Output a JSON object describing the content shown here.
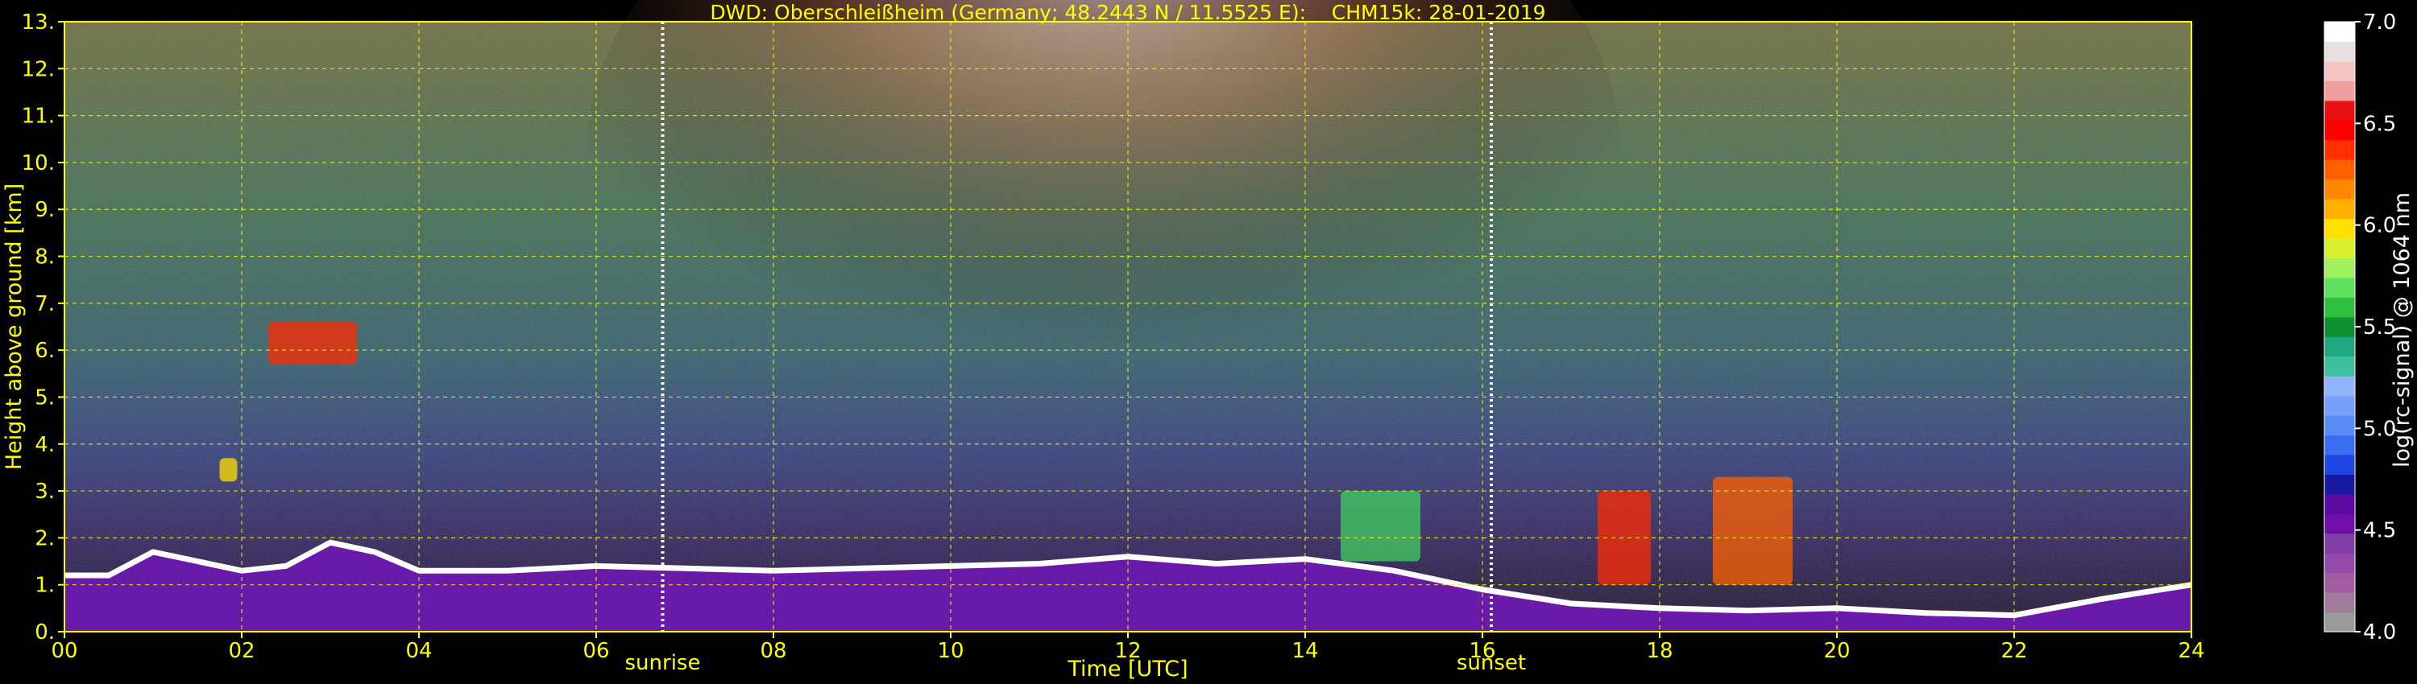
{
  "chart_data": {
    "type": "heatmap",
    "title": "DWD: Oberschleißheim (Germany; 48.2443 N / 11.5525 E):    CHM15k: 28-01-2019",
    "xlabel": "Time [UTC]",
    "ylabel": "Height above ground [km]",
    "xlim": [
      0,
      24
    ],
    "ylim": [
      0,
      13
    ],
    "x_ticks": [
      "00",
      "02",
      "04",
      "06",
      "08",
      "10",
      "12",
      "14",
      "16",
      "18",
      "20",
      "22",
      "24"
    ],
    "y_ticks": [
      "0.",
      "1.",
      "2.",
      "3.",
      "4.",
      "5.",
      "6.",
      "7.",
      "8.",
      "9.",
      "10.",
      "11.",
      "12.",
      "13."
    ],
    "grid": true,
    "markers": [
      {
        "label": "sunrise",
        "time_utc": 6.75
      },
      {
        "label": "sunset",
        "time_utc": 16.1
      }
    ],
    "colorbar": {
      "label": "log(rc-signal) @ 1064 nm",
      "range": [
        4.0,
        7.0
      ],
      "ticks": [
        "4.0",
        "4.5",
        "5.0",
        "5.5",
        "6.0",
        "6.5",
        "7.0"
      ],
      "colors": [
        "#9a9a9a",
        "#a07c9c",
        "#a45ca0",
        "#9448a8",
        "#8040a8",
        "#7010a8",
        "#5a0aa0",
        "#1a1aa0",
        "#1e46e0",
        "#3a6ef0",
        "#5a8cf8",
        "#78a0f8",
        "#90b4f8",
        "#40c0a0",
        "#20a880",
        "#109030",
        "#30c040",
        "#60e060",
        "#a0f060",
        "#d8f030",
        "#ffe000",
        "#ffb000",
        "#ff8800",
        "#ff6000",
        "#ff3000",
        "#ff0000",
        "#e81010",
        "#f0a0a0",
        "#f4c4c4",
        "#e8e0e0",
        "#ffffff"
      ]
    },
    "boundary_layer_km": [
      [
        0.0,
        1.2
      ],
      [
        0.5,
        1.2
      ],
      [
        1.0,
        1.7
      ],
      [
        1.5,
        1.5
      ],
      [
        2.0,
        1.3
      ],
      [
        2.5,
        1.4
      ],
      [
        3.0,
        1.9
      ],
      [
        3.5,
        1.7
      ],
      [
        4.0,
        1.3
      ],
      [
        5.0,
        1.3
      ],
      [
        6.0,
        1.4
      ],
      [
        7.0,
        1.35
      ],
      [
        8.0,
        1.3
      ],
      [
        9.0,
        1.35
      ],
      [
        10.0,
        1.4
      ],
      [
        11.0,
        1.45
      ],
      [
        12.0,
        1.6
      ],
      [
        13.0,
        1.45
      ],
      [
        14.0,
        1.55
      ],
      [
        15.0,
        1.3
      ],
      [
        16.0,
        0.9
      ],
      [
        17.0,
        0.6
      ],
      [
        18.0,
        0.5
      ],
      [
        19.0,
        0.45
      ],
      [
        20.0,
        0.5
      ],
      [
        21.0,
        0.4
      ],
      [
        22.0,
        0.35
      ],
      [
        23.0,
        0.7
      ],
      [
        24.0,
        1.0
      ]
    ],
    "cloud_patches": [
      {
        "time_start": 2.3,
        "time_end": 3.3,
        "base_km": 5.7,
        "top_km": 6.6
      },
      {
        "time_start": 1.75,
        "time_end": 1.95,
        "base_km": 3.2,
        "top_km": 3.7
      },
      {
        "time_start": 14.4,
        "time_end": 15.3,
        "base_km": 1.5,
        "top_km": 3.0
      },
      {
        "time_start": 17.3,
        "time_end": 17.9,
        "base_km": 1.0,
        "top_km": 3.0
      },
      {
        "time_start": 18.6,
        "time_end": 19.5,
        "base_km": 1.0,
        "top_km": 3.3
      }
    ]
  }
}
